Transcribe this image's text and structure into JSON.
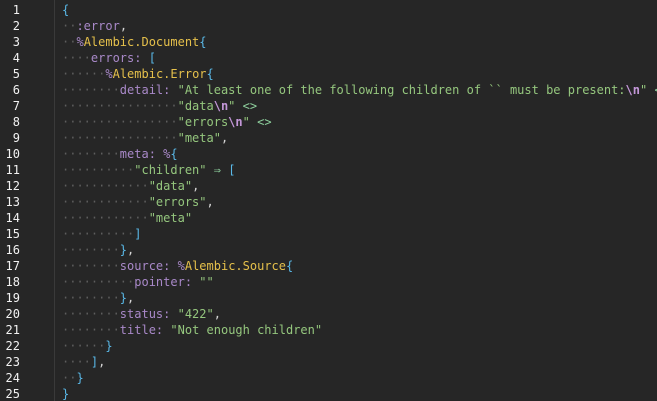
{
  "editor": {
    "line_numbers": [
      "1",
      "2",
      "3",
      "4",
      "5",
      "6",
      "7",
      "8",
      "9",
      "10",
      "11",
      "12",
      "13",
      "14",
      "15",
      "16",
      "17",
      "18",
      "19",
      "20",
      "21",
      "22",
      "23",
      "24",
      "25"
    ],
    "lines": [
      {
        "guides": "",
        "tokens": [
          [
            "brace",
            "{"
          ]
        ]
      },
      {
        "guides": "··",
        "tokens": [
          [
            "atom",
            ":error"
          ],
          [
            "punct",
            ","
          ]
        ]
      },
      {
        "guides": "··",
        "tokens": [
          [
            "pct",
            "%"
          ],
          [
            "module",
            "Alembic.Document"
          ],
          [
            "brace",
            "{"
          ]
        ]
      },
      {
        "guides": "····",
        "tokens": [
          [
            "key",
            "errors:"
          ],
          [
            "punct",
            " "
          ],
          [
            "brace",
            "["
          ]
        ]
      },
      {
        "guides": "······",
        "tokens": [
          [
            "pct",
            "%"
          ],
          [
            "module",
            "Alembic.Error"
          ],
          [
            "brace",
            "{"
          ]
        ]
      },
      {
        "guides": "········",
        "tokens": [
          [
            "key",
            "detail:"
          ],
          [
            "punct",
            " "
          ],
          [
            "str",
            "\"At least one of the following children of `` must be present:"
          ],
          [
            "esc",
            "\\n"
          ],
          [
            "str",
            "\""
          ],
          [
            "punct",
            " "
          ],
          [
            "op",
            "<>"
          ]
        ]
      },
      {
        "guides": "················",
        "tokens": [
          [
            "str",
            "\"data"
          ],
          [
            "esc",
            "\\n"
          ],
          [
            "str",
            "\""
          ],
          [
            "punct",
            " "
          ],
          [
            "op",
            "<>"
          ]
        ]
      },
      {
        "guides": "················",
        "tokens": [
          [
            "str",
            "\"errors"
          ],
          [
            "esc",
            "\\n"
          ],
          [
            "str",
            "\""
          ],
          [
            "punct",
            " "
          ],
          [
            "op",
            "<>"
          ]
        ]
      },
      {
        "guides": "················",
        "tokens": [
          [
            "str",
            "\"meta\""
          ],
          [
            "punct",
            ","
          ]
        ]
      },
      {
        "guides": "········",
        "tokens": [
          [
            "key",
            "meta:"
          ],
          [
            "punct",
            " "
          ],
          [
            "pct",
            "%"
          ],
          [
            "brace",
            "{"
          ]
        ]
      },
      {
        "guides": "··········",
        "tokens": [
          [
            "str",
            "\"children\""
          ],
          [
            "punct",
            " "
          ],
          [
            "op",
            "⇒"
          ],
          [
            "punct",
            " "
          ],
          [
            "brace",
            "["
          ]
        ]
      },
      {
        "guides": "············",
        "tokens": [
          [
            "str",
            "\"data\""
          ],
          [
            "punct",
            ","
          ]
        ]
      },
      {
        "guides": "············",
        "tokens": [
          [
            "str",
            "\"errors\""
          ],
          [
            "punct",
            ","
          ]
        ]
      },
      {
        "guides": "············",
        "tokens": [
          [
            "str",
            "\"meta\""
          ]
        ]
      },
      {
        "guides": "··········",
        "tokens": [
          [
            "brace",
            "]"
          ]
        ]
      },
      {
        "guides": "········",
        "tokens": [
          [
            "brace",
            "}"
          ],
          [
            "punct",
            ","
          ]
        ]
      },
      {
        "guides": "········",
        "tokens": [
          [
            "key",
            "source:"
          ],
          [
            "punct",
            " "
          ],
          [
            "pct",
            "%"
          ],
          [
            "module",
            "Alembic.Source"
          ],
          [
            "brace",
            "{"
          ]
        ]
      },
      {
        "guides": "··········",
        "tokens": [
          [
            "key",
            "pointer:"
          ],
          [
            "punct",
            " "
          ],
          [
            "str",
            "\"\""
          ]
        ]
      },
      {
        "guides": "········",
        "tokens": [
          [
            "brace",
            "}"
          ],
          [
            "punct",
            ","
          ]
        ]
      },
      {
        "guides": "········",
        "tokens": [
          [
            "key",
            "status:"
          ],
          [
            "punct",
            " "
          ],
          [
            "str",
            "\"422\""
          ],
          [
            "punct",
            ","
          ]
        ]
      },
      {
        "guides": "········",
        "tokens": [
          [
            "key",
            "title:"
          ],
          [
            "punct",
            " "
          ],
          [
            "str",
            "\"Not enough children\""
          ]
        ]
      },
      {
        "guides": "······",
        "tokens": [
          [
            "brace",
            "}"
          ]
        ]
      },
      {
        "guides": "····",
        "tokens": [
          [
            "brace",
            "]"
          ],
          [
            "punct",
            ","
          ]
        ]
      },
      {
        "guides": "··",
        "tokens": [
          [
            "brace",
            "}"
          ]
        ]
      },
      {
        "guides": "",
        "tokens": [
          [
            "brace",
            "}"
          ]
        ]
      }
    ]
  }
}
